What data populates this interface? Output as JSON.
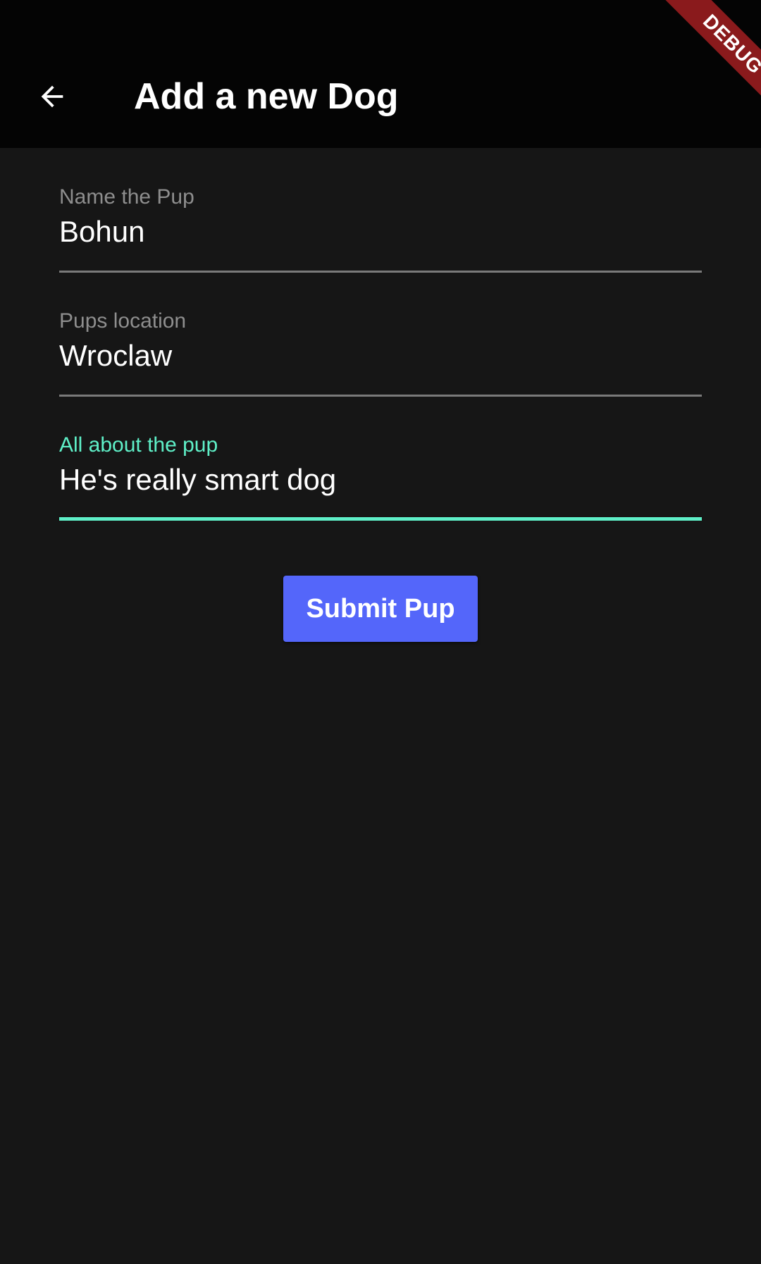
{
  "app_bar": {
    "title": "Add a new Dog",
    "back_icon": "arrow-back-icon",
    "background": "#040404"
  },
  "debug_banner": {
    "label": "DEBUG",
    "color": "#8a1a1c"
  },
  "form": {
    "fields": [
      {
        "label": "Name the Pup",
        "value": "Bohun",
        "focused": false
      },
      {
        "label": "Pups location",
        "value": "Wroclaw",
        "focused": false
      },
      {
        "label": "All about the pup",
        "value": "He's really smart dog",
        "focused": true
      }
    ],
    "accent_color": "#5ff0c8",
    "submit_label": "Submit Pup",
    "submit_color": "#5466fa"
  }
}
